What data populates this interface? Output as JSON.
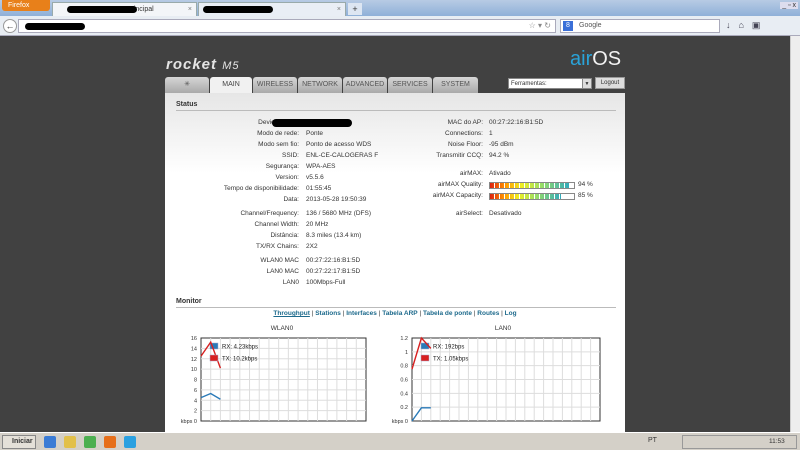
{
  "browser": {
    "menu_button": "Firefox",
    "tabs": [
      {
        "label": "...Principal"
      },
      {
        "label": "..."
      }
    ],
    "new_tab": "+",
    "search_placeholder": "Google",
    "url": "...",
    "window_controls": "_ ▫ x"
  },
  "header": {
    "logo": "rocket",
    "logo_model": "M5",
    "brand": "air",
    "brand2": "OS",
    "nav_tabs": [
      "",
      "MAIN",
      "WIRELESS",
      "NETWORK",
      "ADVANCED",
      "SERVICES",
      "SYSTEM"
    ],
    "tools_select": "Ferramentas:",
    "logout": "Logout"
  },
  "status": {
    "title": "Status",
    "left": [
      {
        "label": "Device Name:",
        "value": ""
      },
      {
        "label": "Modo de rede:",
        "value": "Ponte"
      },
      {
        "label": "Modo sem fio:",
        "value": "Ponto de acesso WDS"
      },
      {
        "label": "SSID:",
        "value": "ENL-CE-CALOGERAS F"
      },
      {
        "label": "Segurança:",
        "value": "WPA-AES"
      },
      {
        "label": "Version:",
        "value": "v5.5.6"
      },
      {
        "label": "Tempo de disponibilidade:",
        "value": "01:55:45"
      },
      {
        "label": "Data:",
        "value": "2013-05-28 19:50:39"
      },
      {
        "label": "Channel/Frequency:",
        "value": "136 / 5680 MHz (DFS)"
      },
      {
        "label": "Channel Width:",
        "value": "20 MHz"
      },
      {
        "label": "Distância:",
        "value": "8.3 miles (13.4 km)"
      },
      {
        "label": "TX/RX Chains:",
        "value": "2X2"
      },
      {
        "label": "WLAN0 MAC",
        "value": "00:27:22:16:B1:5D"
      },
      {
        "label": "LAN0 MAC",
        "value": "00:27:22:17:B1:5D"
      },
      {
        "label": "LAN0",
        "value": "100Mbps-Full"
      }
    ],
    "right": [
      {
        "label": "MAC do AP:",
        "value": "00:27:22:16:B1:5D"
      },
      {
        "label": "Connections:",
        "value": "1"
      },
      {
        "label": "Noise Floor:",
        "value": "-95 dBm"
      },
      {
        "label": "Transmitir CCQ:",
        "value": "94.2 %"
      },
      {
        "label": "airMAX:",
        "value": "Ativado"
      },
      {
        "label": "airMAX Quality:",
        "value": "94 %",
        "percent": 94
      },
      {
        "label": "airMAX Capacity:",
        "value": "85 %",
        "percent": 85
      },
      {
        "label": "airSelect:",
        "value": "Desativado"
      }
    ]
  },
  "monitor": {
    "title": "Monitor",
    "links": [
      "Throughput",
      "Stations",
      "Interfaces",
      "Tabela ARP",
      "Tabela de ponte",
      "Routes",
      "Log"
    ],
    "sep": "|"
  },
  "chart_data": [
    {
      "type": "line",
      "title": "WLAN0",
      "ylabel": "kbps",
      "ylim": [
        0,
        16
      ],
      "yticks": [
        "kbps 0",
        "2",
        "4",
        "6",
        "8",
        "10",
        "12",
        "14",
        "16"
      ],
      "legend": [
        "RX: 4.23kbps",
        "TX: 10.2kbps"
      ],
      "series": [
        {
          "name": "RX",
          "color": "#2a7ab8",
          "values": [
            4.5,
            5.3,
            4.2
          ]
        },
        {
          "name": "TX",
          "color": "#d82020",
          "values": [
            12.5,
            15.2,
            10.2
          ]
        }
      ]
    },
    {
      "type": "line",
      "title": "LAN0",
      "ylabel": "kbps",
      "ylim": [
        0,
        1.2
      ],
      "yticks": [
        "kbps 0",
        "0.2",
        "0.4",
        "0.6",
        "0.8",
        "1",
        "1.2"
      ],
      "legend": [
        "RX: 192bps",
        "TX: 1.05kbps"
      ],
      "series": [
        {
          "name": "RX",
          "color": "#2a7ab8",
          "values": [
            0,
            0.19,
            0.19
          ]
        },
        {
          "name": "TX",
          "color": "#d82020",
          "values": [
            0.75,
            1.2,
            1.05
          ]
        }
      ]
    }
  ],
  "taskbar": {
    "start": "Iniciar",
    "lang": "PT",
    "clock": "11:53"
  }
}
